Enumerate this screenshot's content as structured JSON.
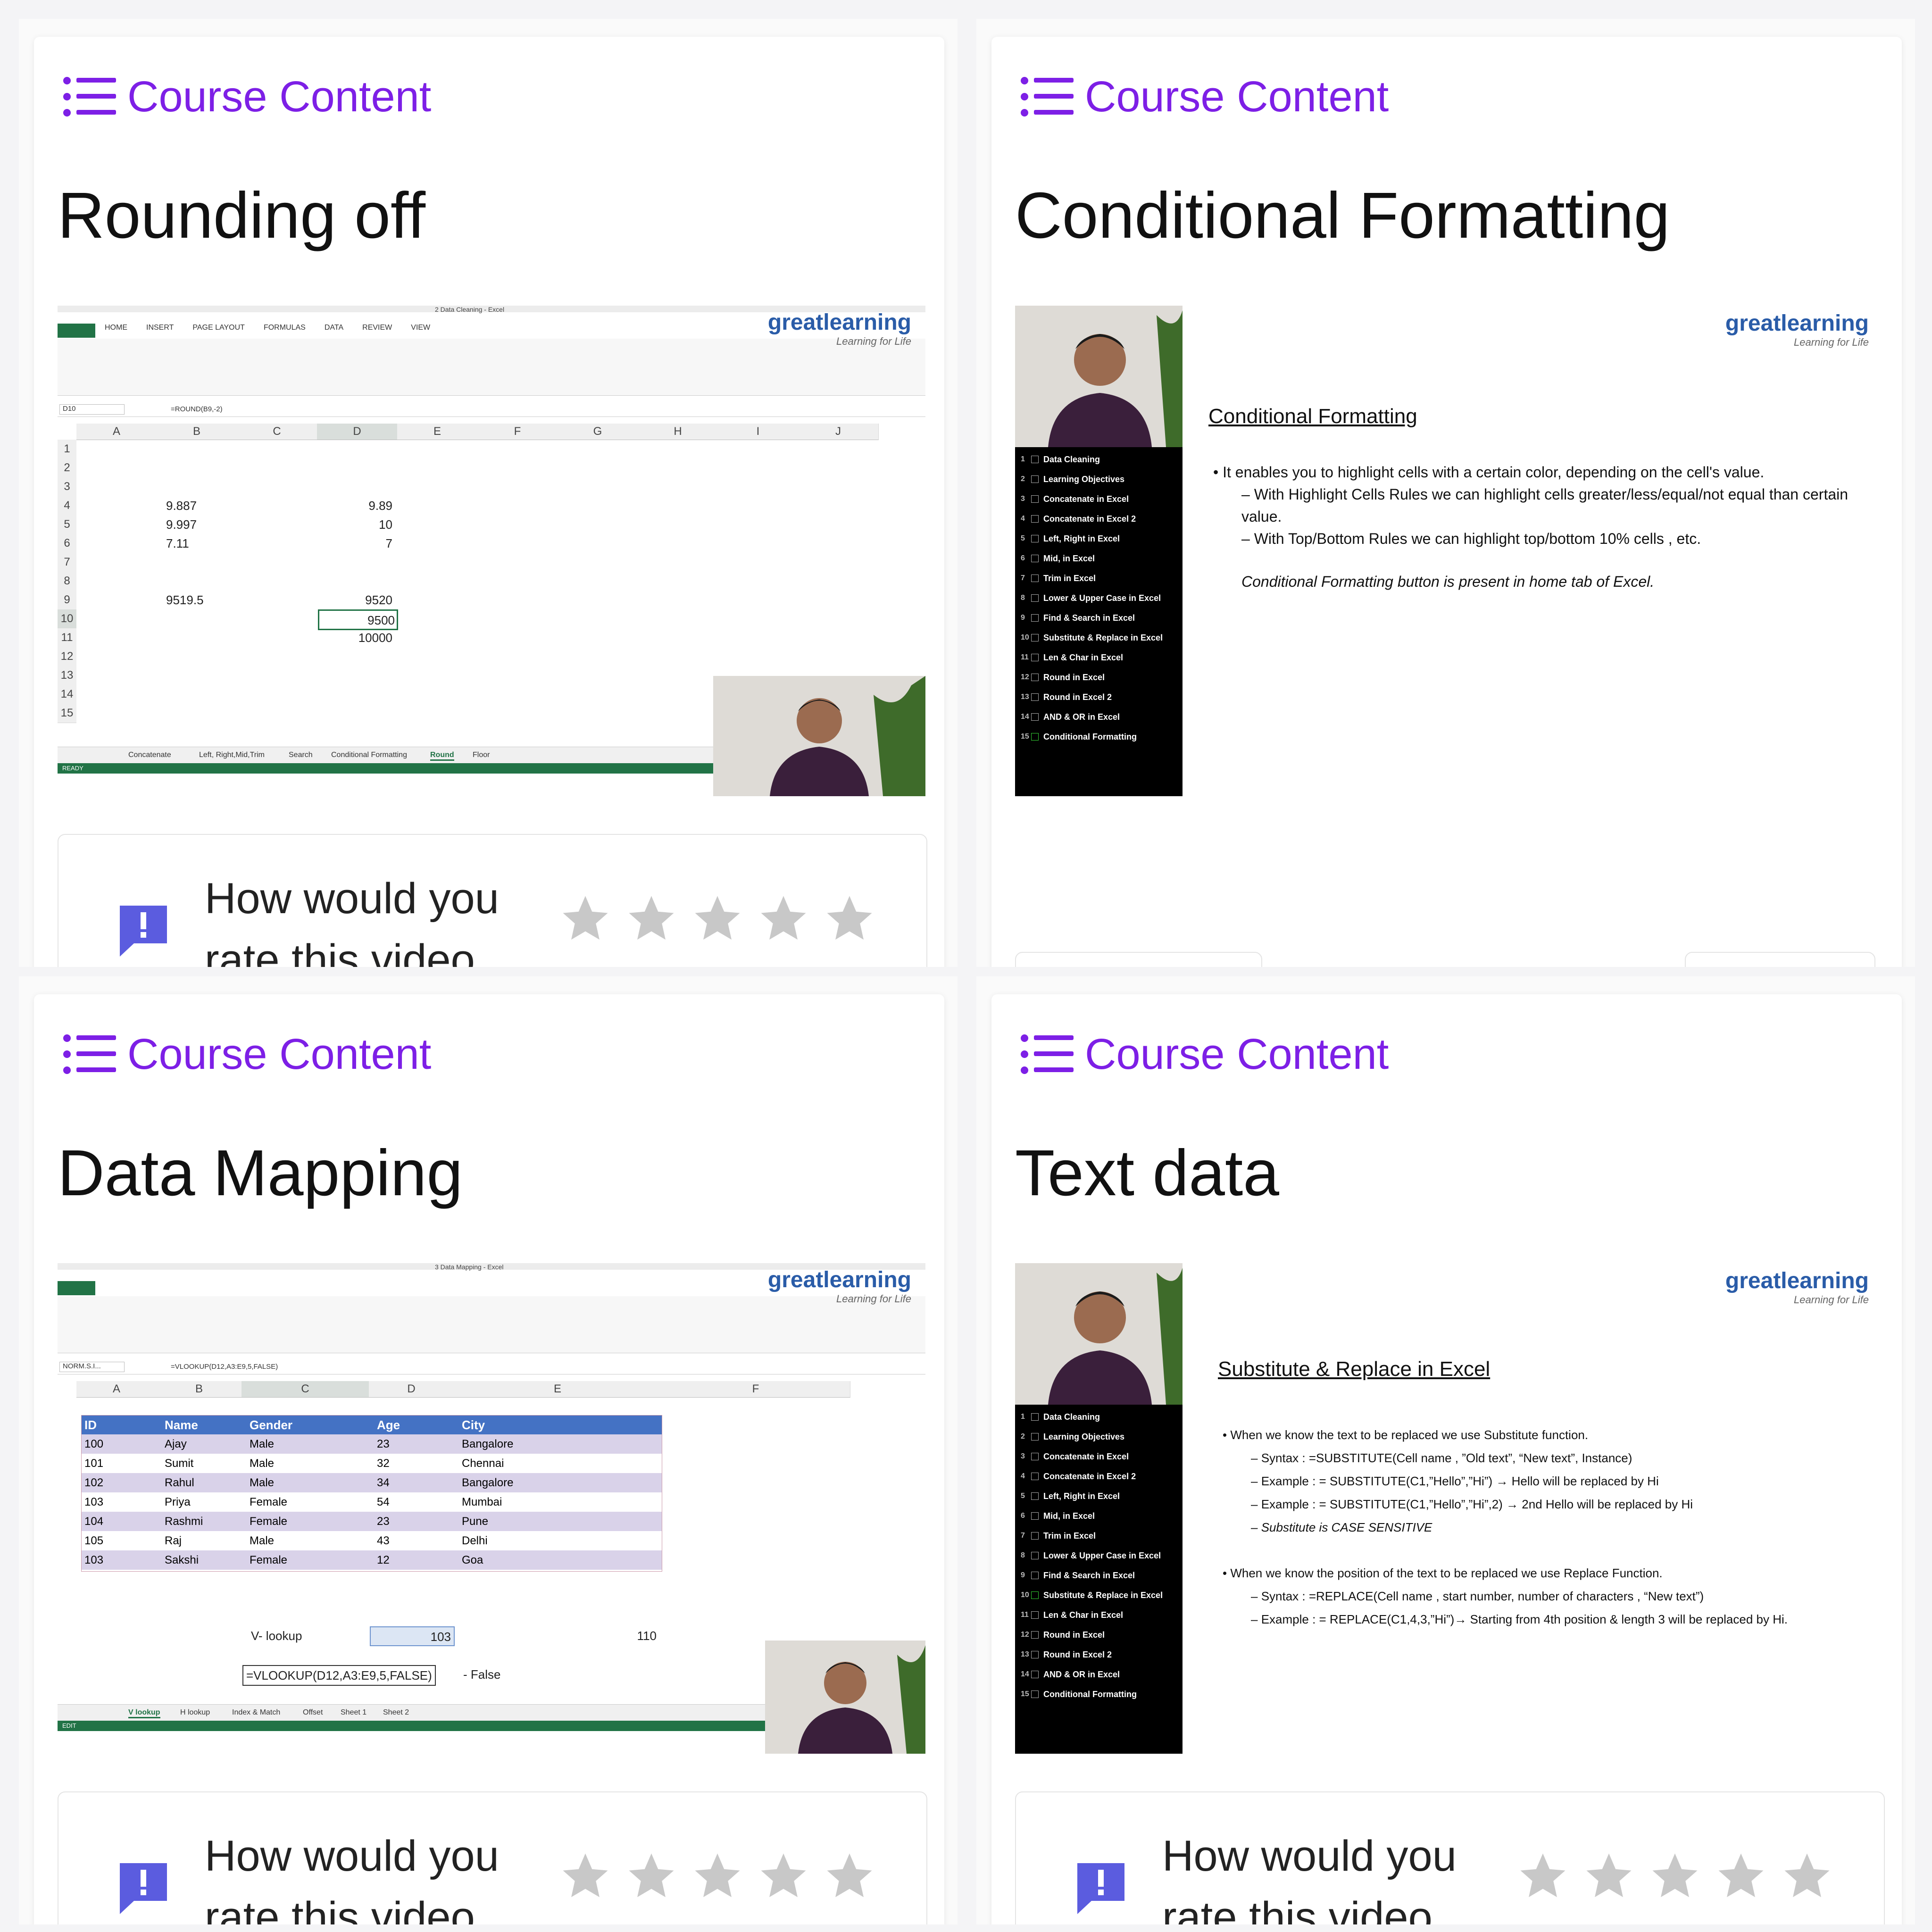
{
  "panels": [
    {
      "header": "Course Content",
      "title": "Rounding off",
      "rating": {
        "prompt_line1": "How would you",
        "prompt_line2": "rate this video"
      },
      "excel": {
        "window_title": "2 Data Cleaning - Excel",
        "tabs": [
          "FILE",
          "HOME",
          "INSERT",
          "PAGE LAYOUT",
          "FORMULAS",
          "DATA",
          "REVIEW",
          "VIEW"
        ],
        "name_box": "D10",
        "formula": "=ROUND(B9,-2)",
        "columns": [
          "A",
          "B",
          "C",
          "D",
          "E",
          "F",
          "G",
          "H",
          "I",
          "J"
        ],
        "rows": [
          "1",
          "2",
          "3",
          "4",
          "5",
          "6",
          "7",
          "8",
          "9",
          "10",
          "11",
          "12",
          "13",
          "14",
          "15"
        ],
        "cells": {
          "b4": "9.887",
          "d4": "9.89",
          "b5": "9.997",
          "d5": "10",
          "b6": "7.11",
          "d6": "7",
          "b9": "9519.5",
          "d9": "9520",
          "d10": "9500",
          "d11": "10000"
        },
        "sheet_tabs": [
          "Concatenate",
          "Left, Right,Mid,Trim",
          "Search",
          "Conditional Formatting",
          "Round",
          "Floor"
        ],
        "active_sheet": "Round",
        "status": "READY"
      },
      "logo": {
        "brand": "greatlearning",
        "tagline": "Learning for Life"
      }
    },
    {
      "header": "Course Content",
      "title": "Conditional Formatting",
      "slide": {
        "heading": "Conditional Formatting",
        "bullets": [
          "It enables you to highlight cells with a certain color, depending on the cell's value.",
          "With Highlight Cells Rules  we can highlight cells greater/less/equal/not equal than certain value.",
          "With Top/Bottom Rules we can highlight top/bottom 10% cells , etc."
        ],
        "note": "Conditional Formatting button is present in home tab of Excel.",
        "toc": [
          "Data Cleaning",
          "Learning Objectives",
          "Concatenate in Excel",
          "Concatenate in Excel 2",
          "Left, Right in Excel",
          "Mid, in Excel",
          "Trim in Excel",
          "Lower & Upper Case in Excel",
          "Find & Search in Excel",
          "Substitute & Replace in Excel",
          "Len & Char in Excel",
          "Round in Excel",
          "Round in Excel 2",
          "AND & OR in Excel",
          "Conditional Formatting"
        ]
      },
      "logo": {
        "brand": "greatlearning",
        "tagline": "Learning for Life"
      }
    },
    {
      "header": "Course Content",
      "title": "Data Mapping",
      "rating": {
        "prompt_line1": "How would you",
        "prompt_line2": "rate this video"
      },
      "excel": {
        "window_title": "3 Data Mapping - Excel",
        "name_box": "NORM.S.I...",
        "formula": "=VLOOKUP(D12,A3:E9,5,FALSE)",
        "columns": [
          "A",
          "B",
          "C",
          "D",
          "E",
          "F"
        ],
        "table_headers": [
          "ID",
          "Name",
          "Gender",
          "Age",
          "City"
        ],
        "table_rows": [
          [
            "100",
            "Ajay",
            "Male",
            "23",
            "Bangalore"
          ],
          [
            "101",
            "Sumit",
            "Male",
            "32",
            "Chennai"
          ],
          [
            "102",
            "Rahul",
            "Male",
            "34",
            "Bangalore"
          ],
          [
            "103",
            "Priya",
            "Female",
            "54",
            "Mumbai"
          ],
          [
            "104",
            "Rashmi",
            "Female",
            "23",
            "Pune"
          ],
          [
            "105",
            "Raj",
            "Male",
            "43",
            "Delhi"
          ],
          [
            "103",
            "Sakshi",
            "Female",
            "12",
            "Goa"
          ]
        ],
        "lookup_label": "V- lookup",
        "lookup_value": "103",
        "lookup_e": "110",
        "formula_cell": "=VLOOKUP(D12,A3:E9,5,FALSE)",
        "formula_note": "- False",
        "sheet_tabs": [
          "V lookup",
          "H lookup",
          "Index & Match",
          "Offset",
          "Sheet 1",
          "Sheet 2"
        ],
        "active_sheet": "V lookup",
        "status": "EDIT"
      },
      "logo": {
        "brand": "greatlearning",
        "tagline": "Learning for Life"
      }
    },
    {
      "header": "Course Content",
      "title": "Text data",
      "rating": {
        "prompt_line1": "How would you",
        "prompt_line2": "rate this video"
      },
      "slide": {
        "heading": "Substitute & Replace in Excel",
        "lines": [
          "When we know the text to be replaced we use Substitute function.",
          "Syntax : =SUBSTITUTE(Cell name , ”Old text”, “New text”, Instance)",
          "Example : = SUBSTITUTE(C1,”Hello”,”Hi”) → Hello will be replaced by Hi",
          "Example : = SUBSTITUTE(C1,”Hello”,”Hi”,2) → 2nd  Hello will be replaced by Hi",
          "Substitute is CASE SENSITIVE",
          "When we know the position of the text to be replaced we use Replace Function.",
          "Syntax : =REPLACE(Cell name , start number, number of characters , “New text”)",
          "Example : = REPLACE(C1,4,3,”Hi”)→ Starting from 4th position & length 3 will be replaced by Hi."
        ],
        "toc": [
          "Data Cleaning",
          "Learning Objectives",
          "Concatenate in Excel",
          "Concatenate in Excel 2",
          "Left, Right in Excel",
          "Mid, in Excel",
          "Trim in Excel",
          "Lower & Upper Case in Excel",
          "Find & Search in Excel",
          "Substitute & Replace in Excel",
          "Len & Char in Excel",
          "Round in Excel",
          "Round in Excel 2",
          "AND & OR in Excel",
          "Conditional Formatting"
        ]
      },
      "logo": {
        "brand": "greatlearning",
        "tagline": "Learning for Life"
      }
    }
  ],
  "colors": {
    "accent": "#7d1fe6",
    "excel_green": "#217346",
    "table_header": "#4472c4",
    "table_band": "#d9d2e9",
    "star": "#c8c8c8"
  }
}
